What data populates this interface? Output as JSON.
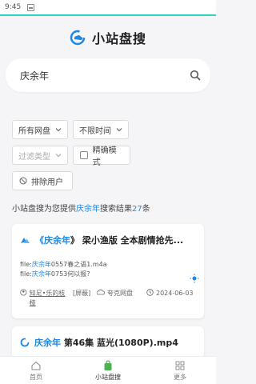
{
  "status": {
    "time": "9:45"
  },
  "colors": {
    "accent": "#2fd3c3",
    "link": "#1e88e5",
    "active_tab": "#4caf50"
  },
  "header": {
    "title": "小站盘搜",
    "logo_icon": "cloud-logo-icon"
  },
  "search": {
    "value": "庆余年",
    "icon": "search-icon"
  },
  "filters": {
    "drive": "所有网盘",
    "time": "不限时间",
    "type": "过滤类型",
    "exact": "精确模式",
    "exclude": "排除用户"
  },
  "result": {
    "prefix": "小站盘搜为您提供",
    "keyword": "庆余年",
    "middle": "搜索结果",
    "count": "27",
    "suffix": "条"
  },
  "cards": [
    {
      "title_pre": "《",
      "title_key": "庆余年",
      "title_post": "》 梁小渔版 全本剧情抢先...",
      "files": [
        {
          "pre": "file:",
          "key": "庆余年",
          "rest": "0557春之语1.m4a"
        },
        {
          "pre": "file:",
          "key": "庆余年",
          "rest": "0753何以报?"
        }
      ],
      "user": "知足•乐的枝桠",
      "tag": "[屏蔽]",
      "drive": "夸克网盘",
      "date": "2024-06-03"
    },
    {
      "title_key": "庆余年",
      "title_post": " 第46集 蓝光(1080P).mp4"
    }
  ],
  "tabs": [
    {
      "label": "首页",
      "icon": "home-icon"
    },
    {
      "label": "小站盘搜",
      "icon": "bag-icon"
    },
    {
      "label": "更多",
      "icon": "grid-icon"
    }
  ]
}
